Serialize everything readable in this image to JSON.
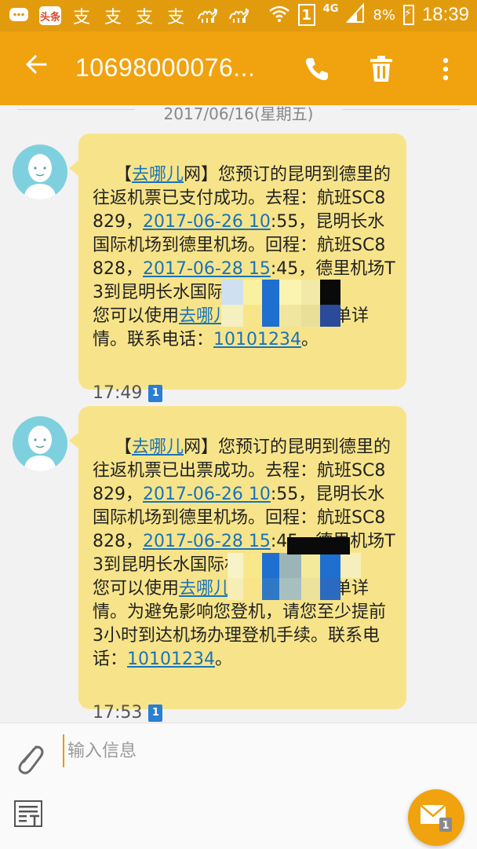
{
  "status_bar": {
    "app_badge": "头条",
    "sim_slot": "1",
    "network": "4G",
    "battery_percent": "8%",
    "time": "18:39"
  },
  "app_bar": {
    "title": "10698000076..."
  },
  "date_divider": "2017/06/16(星期五)",
  "messages": [
    {
      "parts": [
        {
          "text": "【",
          "link": false
        },
        {
          "text": "去哪儿",
          "link": true
        },
        {
          "text": "网】您预订的昆明到德里的往返机票已支付成功。去程：航班SC8829，",
          "link": false
        },
        {
          "text": "2017-06-26 10",
          "link": true
        },
        {
          "text": ":55，昆明长水国际机场到德里机场。回程：航班SC8828，",
          "link": false
        },
        {
          "text": "2017-06-28 15",
          "link": true
        },
        {
          "text": ":45，德里机场T3到昆明长水国际机场。订单号：",
          "link": false
        },
        {
          "text": "",
          "link": false
        },
        {
          "text": "您可以使用",
          "link": false
        },
        {
          "text": "去哪儿",
          "link": true
        },
        {
          "text": "客户端查看订单详情。联系电话：",
          "link": false
        },
        {
          "text": "10101234",
          "link": true
        },
        {
          "text": "。",
          "link": false
        }
      ],
      "time": "17:49",
      "sim": "1"
    },
    {
      "parts": [
        {
          "text": "【",
          "link": false
        },
        {
          "text": "去哪儿",
          "link": true
        },
        {
          "text": "网】您预订的昆明到德里的往返机票已出票成功。去程：航班SC8829，",
          "link": false
        },
        {
          "text": "2017-06-26 10",
          "link": true
        },
        {
          "text": ":55，昆明长水国际机场到德里机场。回程：航班SC8828，",
          "link": false
        },
        {
          "text": "2017-06-28 15",
          "link": true
        },
        {
          "text": ":45，德里机场T3到昆明长水国际机场。订单号：",
          "link": false
        },
        {
          "text": "",
          "link": false
        },
        {
          "text": "您可以使用",
          "link": false
        },
        {
          "text": "去哪儿",
          "link": true
        },
        {
          "text": "客户端查看订单详情。为避免影响您登机，请您至少提前3小时到达机场办理登机手续。联系电话：",
          "link": false
        },
        {
          "text": "10101234",
          "link": true
        },
        {
          "text": "。",
          "link": false
        }
      ],
      "time": "17:53",
      "sim": "1"
    }
  ],
  "composer": {
    "placeholder": "输入信息",
    "send_sim": "1"
  }
}
